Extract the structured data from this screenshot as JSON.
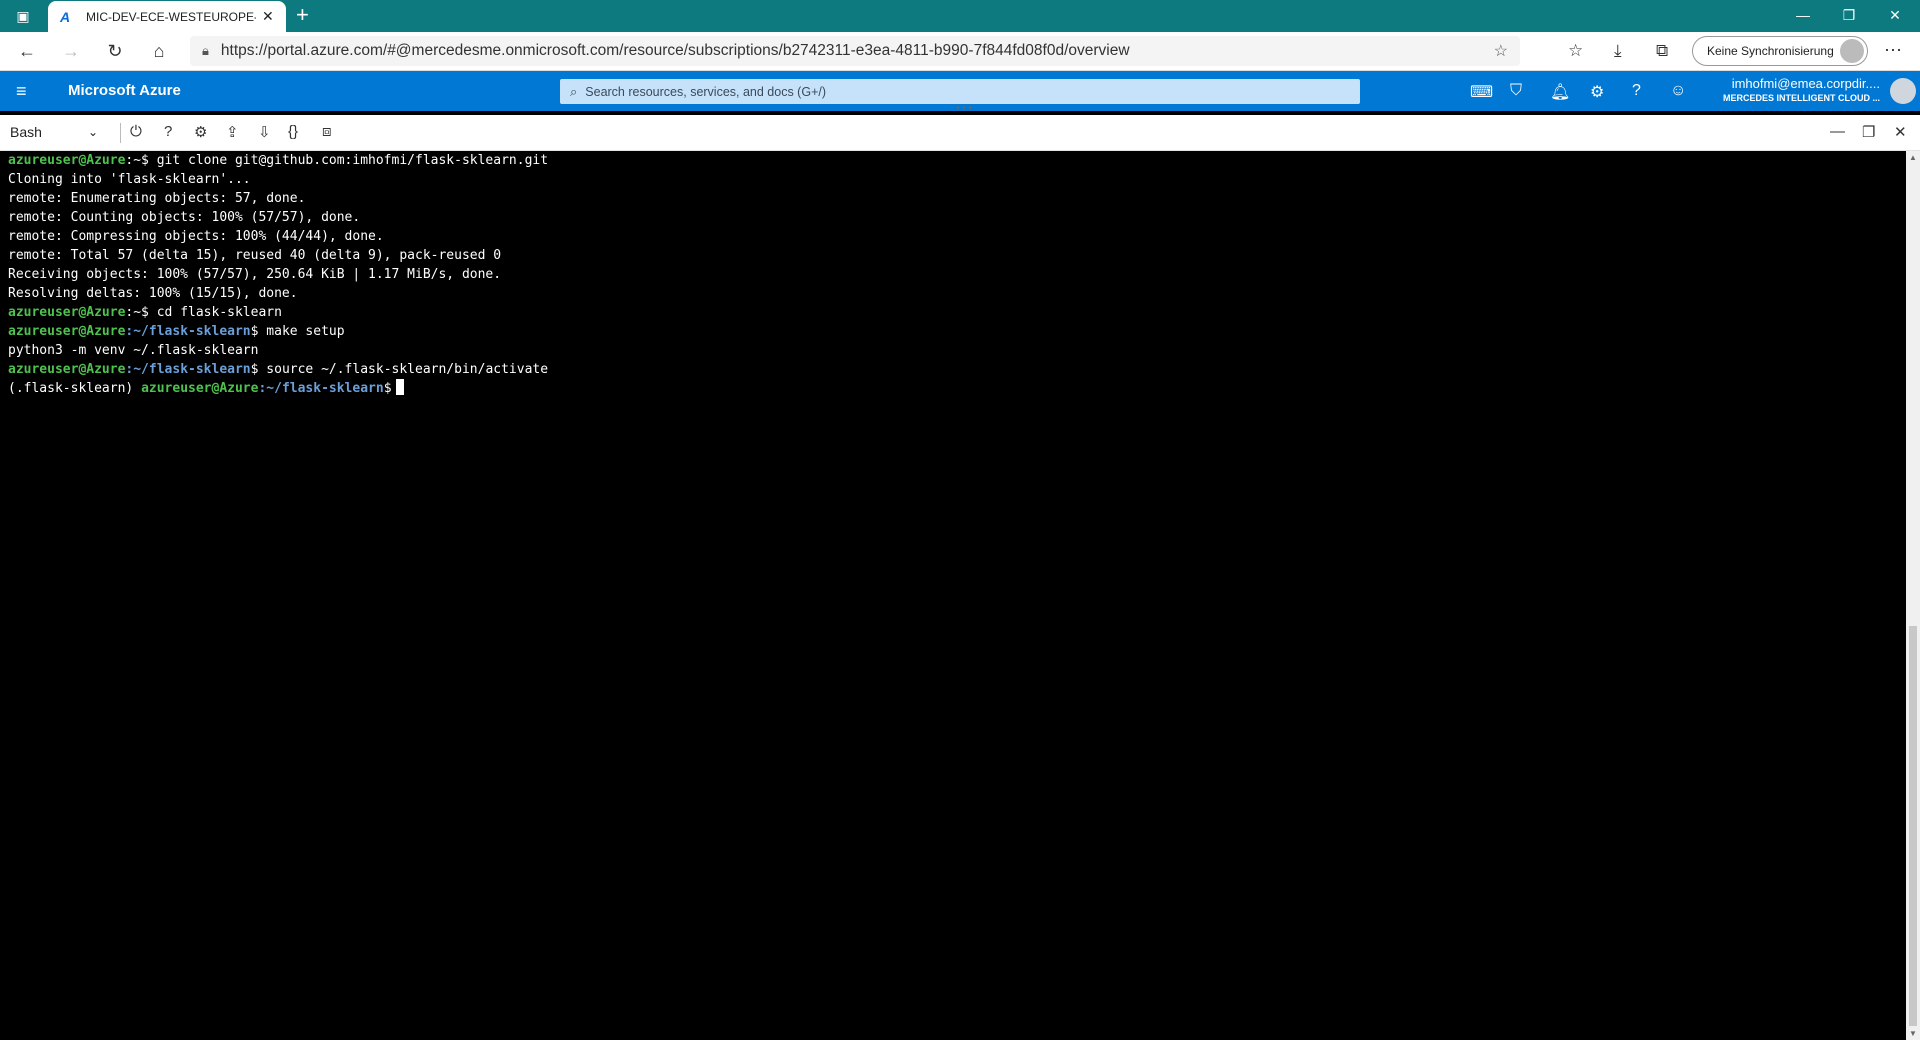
{
  "browser": {
    "tab_title": "MIC-DEV-ECE-WESTEUROPE-DD",
    "new_tab": "+",
    "url": "https://portal.azure.com/#@mercedesme.onmicrosoft.com/resource/subscriptions/b2742311-e3ea-4811-b990-7f844fd08f0d/overview",
    "sync_label": "Keine Synchronisierung"
  },
  "azure": {
    "brand": "Microsoft Azure",
    "search_placeholder": "Search resources, services, and docs (G+/)",
    "account_name": "imhofmi@emea.corpdir....",
    "account_directory": "MERCEDES INTELLIGENT CLOUD ..."
  },
  "shell": {
    "selected": "Bash"
  },
  "terminal": {
    "l1_user": "azureuser@Azure",
    "l1_rest": ":~$ git clone git@github.com:imhofmi/flask-sklearn.git",
    "l2": "Cloning into 'flask-sklearn'...",
    "l3": "remote: Enumerating objects: 57, done.",
    "l4": "remote: Counting objects: 100% (57/57), done.",
    "l5": "remote: Compressing objects: 100% (44/44), done.",
    "l6": "remote: Total 57 (delta 15), reused 40 (delta 9), pack-reused 0",
    "l7": "Receiving objects: 100% (57/57), 250.64 KiB | 1.17 MiB/s, done.",
    "l8": "Resolving deltas: 100% (15/15), done.",
    "l9_user": "azureuser@Azure",
    "l9_rest": ":~$ cd flask-sklearn",
    "l10_user": "azureuser@Azure",
    "l10_path": ":~/flask-sklearn",
    "l10_cmd": "$ make setup",
    "l11": "python3 -m venv ~/.flask-sklearn",
    "l12_user": "azureuser@Azure",
    "l12_path": ":~/flask-sklearn",
    "l12_cmd": "$ source ~/.flask-sklearn/bin/activate",
    "l13_env": "(.flask-sklearn) ",
    "l13_user": "azureuser@Azure",
    "l13_path": ":~/flask-sklearn",
    "l13_cmd": "$"
  },
  "colors": {
    "tabbar": "#0d7a7f",
    "azure_blue": "#0078d4",
    "prompt_user": "#4ec24e",
    "prompt_path": "#6a9fd8"
  },
  "icons": [
    "workspaces-icon",
    "azure-logo-icon",
    "tab-close-icon",
    "back-icon",
    "forward-icon",
    "refresh-icon",
    "home-icon",
    "lock-icon",
    "add-favorite-icon",
    "favorites-icon",
    "downloads-icon",
    "collections-icon",
    "more-icon",
    "hamburger-icon",
    "search-icon",
    "cloud-shell-icon",
    "directory-filter-icon",
    "bell-icon",
    "gear-icon",
    "help-icon",
    "feedback-icon",
    "power-icon",
    "upload-icon",
    "download-icon",
    "braces-icon",
    "web-preview-icon",
    "minimize-icon",
    "restore-icon",
    "close-icon"
  ]
}
